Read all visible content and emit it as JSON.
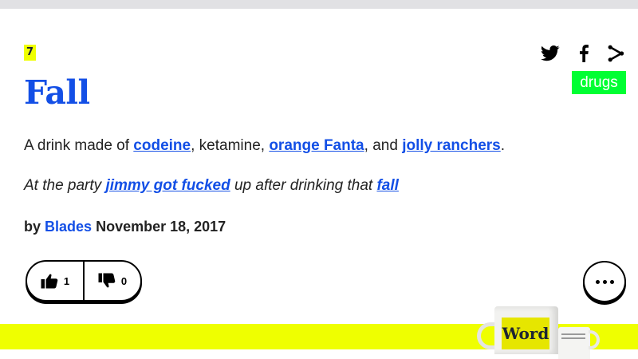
{
  "definition": {
    "rank": "7",
    "word": "Fall",
    "tag": "drugs",
    "meaning": {
      "t1": "A drink made of ",
      "l1": "codeine",
      "t2": ", ketamine, ",
      "l2": "orange Fanta",
      "t3": ", and ",
      "l3": "jolly ranchers",
      "t4": "."
    },
    "example": {
      "t1": "At the party ",
      "l1": "jimmy got fucked",
      "t2": " up after drinking that ",
      "l2": "fall"
    },
    "contributor": {
      "by": "by",
      "author": "Blades",
      "date": "November 18, 2017"
    }
  },
  "votes": {
    "up_count": "1",
    "down_count": "0"
  },
  "share_icons": [
    "twitter-icon",
    "facebook-icon",
    "share-icon"
  ],
  "banner": {
    "mug_text": "Word"
  },
  "colors": {
    "link": "#134fe6",
    "highlight": "#efff00",
    "tag_bg": "#00ff33",
    "text": "#222222",
    "top_bar": "#e1e1e4"
  }
}
